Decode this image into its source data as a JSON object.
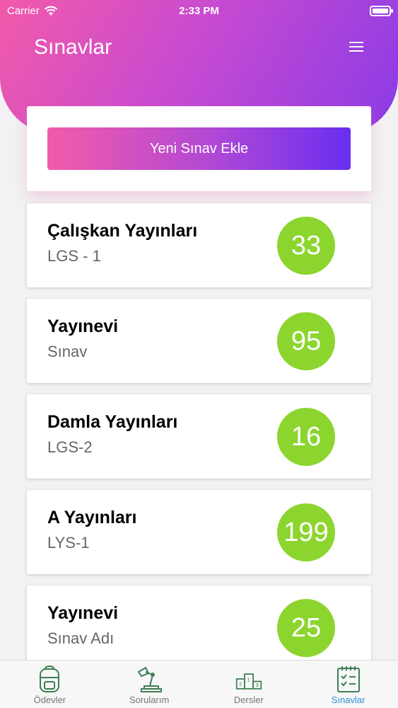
{
  "status_bar": {
    "carrier": "Carrier",
    "time": "2:33 PM"
  },
  "header": {
    "title": "Sınavlar"
  },
  "add_exam": {
    "label": "Yeni Sınav Ekle"
  },
  "exams": [
    {
      "publisher": "Çalışkan Yayınları",
      "name": "LGS - 1",
      "score": "33"
    },
    {
      "publisher": "Yayınevi",
      "name": "Sınav",
      "score": "95"
    },
    {
      "publisher": "Damla Yayınları",
      "name": "LGS-2",
      "score": "16"
    },
    {
      "publisher": "A Yayınları",
      "name": "LYS-1",
      "score": "199"
    },
    {
      "publisher": "Yayınevi",
      "name": "Sınav Adı",
      "score": "25"
    }
  ],
  "tabs": [
    {
      "label": "Ödevler",
      "icon": "backpack-icon"
    },
    {
      "label": "Sorularım",
      "icon": "desk-lamp-icon"
    },
    {
      "label": "Dersler",
      "icon": "podium-icon"
    },
    {
      "label": "Sınavlar",
      "icon": "checklist-icon",
      "active": true
    }
  ],
  "colors": {
    "score_badge": "#8cd52e",
    "tab_active": "#2a8fd6",
    "icon_green": "#3f7d55"
  }
}
